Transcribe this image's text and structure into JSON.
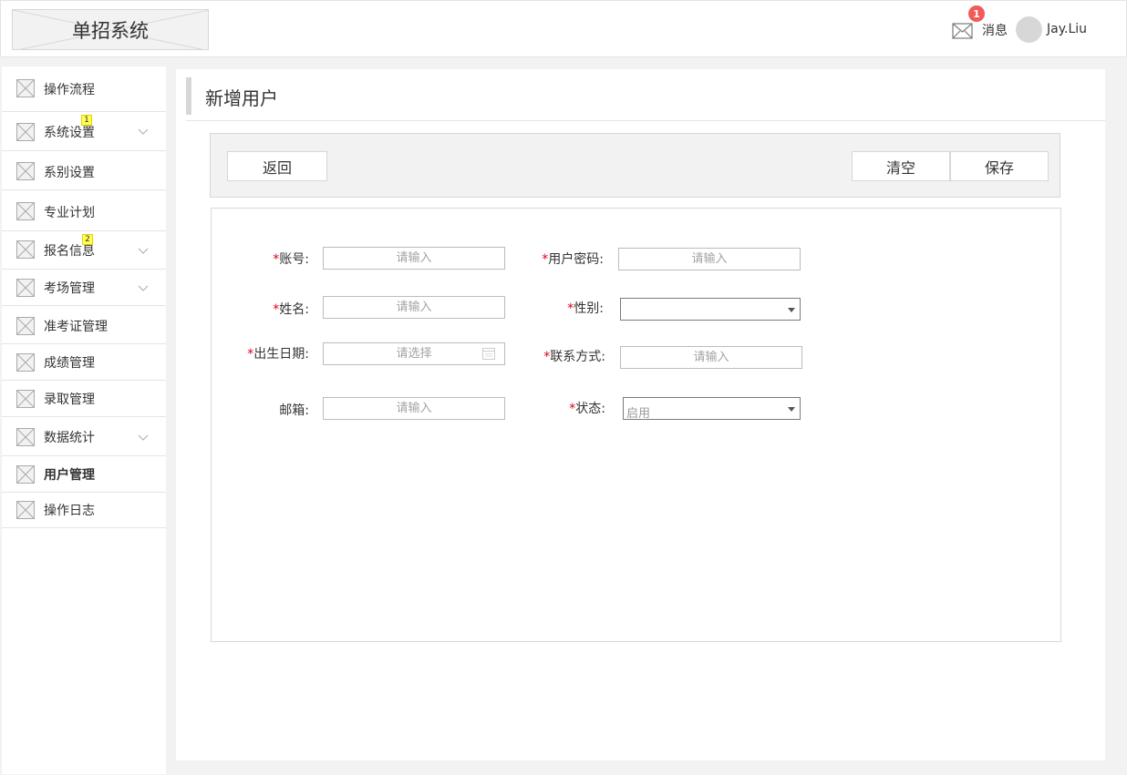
{
  "header": {
    "logo_text": "单招系统",
    "messages_label": "消息",
    "messages_count": "1",
    "username": "Jay.Liu"
  },
  "sidebar": {
    "items": [
      {
        "label": "操作流程"
      },
      {
        "label": "系统设置",
        "badge": "1"
      },
      {
        "label": "系别设置"
      },
      {
        "label": "专业计划"
      },
      {
        "label": "报名信息",
        "badge": "2"
      },
      {
        "label": "考场管理"
      },
      {
        "label": "准考证管理"
      },
      {
        "label": "成绩管理"
      },
      {
        "label": "录取管理"
      },
      {
        "label": "数据统计"
      },
      {
        "label": "用户管理",
        "active": true
      },
      {
        "label": "操作日志"
      }
    ]
  },
  "main": {
    "title": "新增用户",
    "toolbar": {
      "back_label": "返回",
      "clear_label": "清空",
      "save_label": "保存"
    },
    "form": {
      "required_mark": "*",
      "account_label": "账号:",
      "account_placeholder": "请输入",
      "password_label": "用户密码:",
      "password_placeholder": "请输入",
      "name_label": "姓名:",
      "name_placeholder": "请输入",
      "gender_label": "性别:",
      "gender_value": "",
      "birthdate_label": "出生日期:",
      "birthdate_placeholder": "请选择",
      "contact_label": "联系方式:",
      "contact_placeholder": "请输入",
      "email_label": "邮箱:",
      "email_placeholder": "请输入",
      "status_label": "状态:",
      "status_value": "启用"
    }
  },
  "icons": {
    "nav_placeholder": "image-placeholder-icon",
    "chevron": "chevron-down-icon",
    "mail": "mail-icon",
    "calendar": "calendar-icon"
  }
}
